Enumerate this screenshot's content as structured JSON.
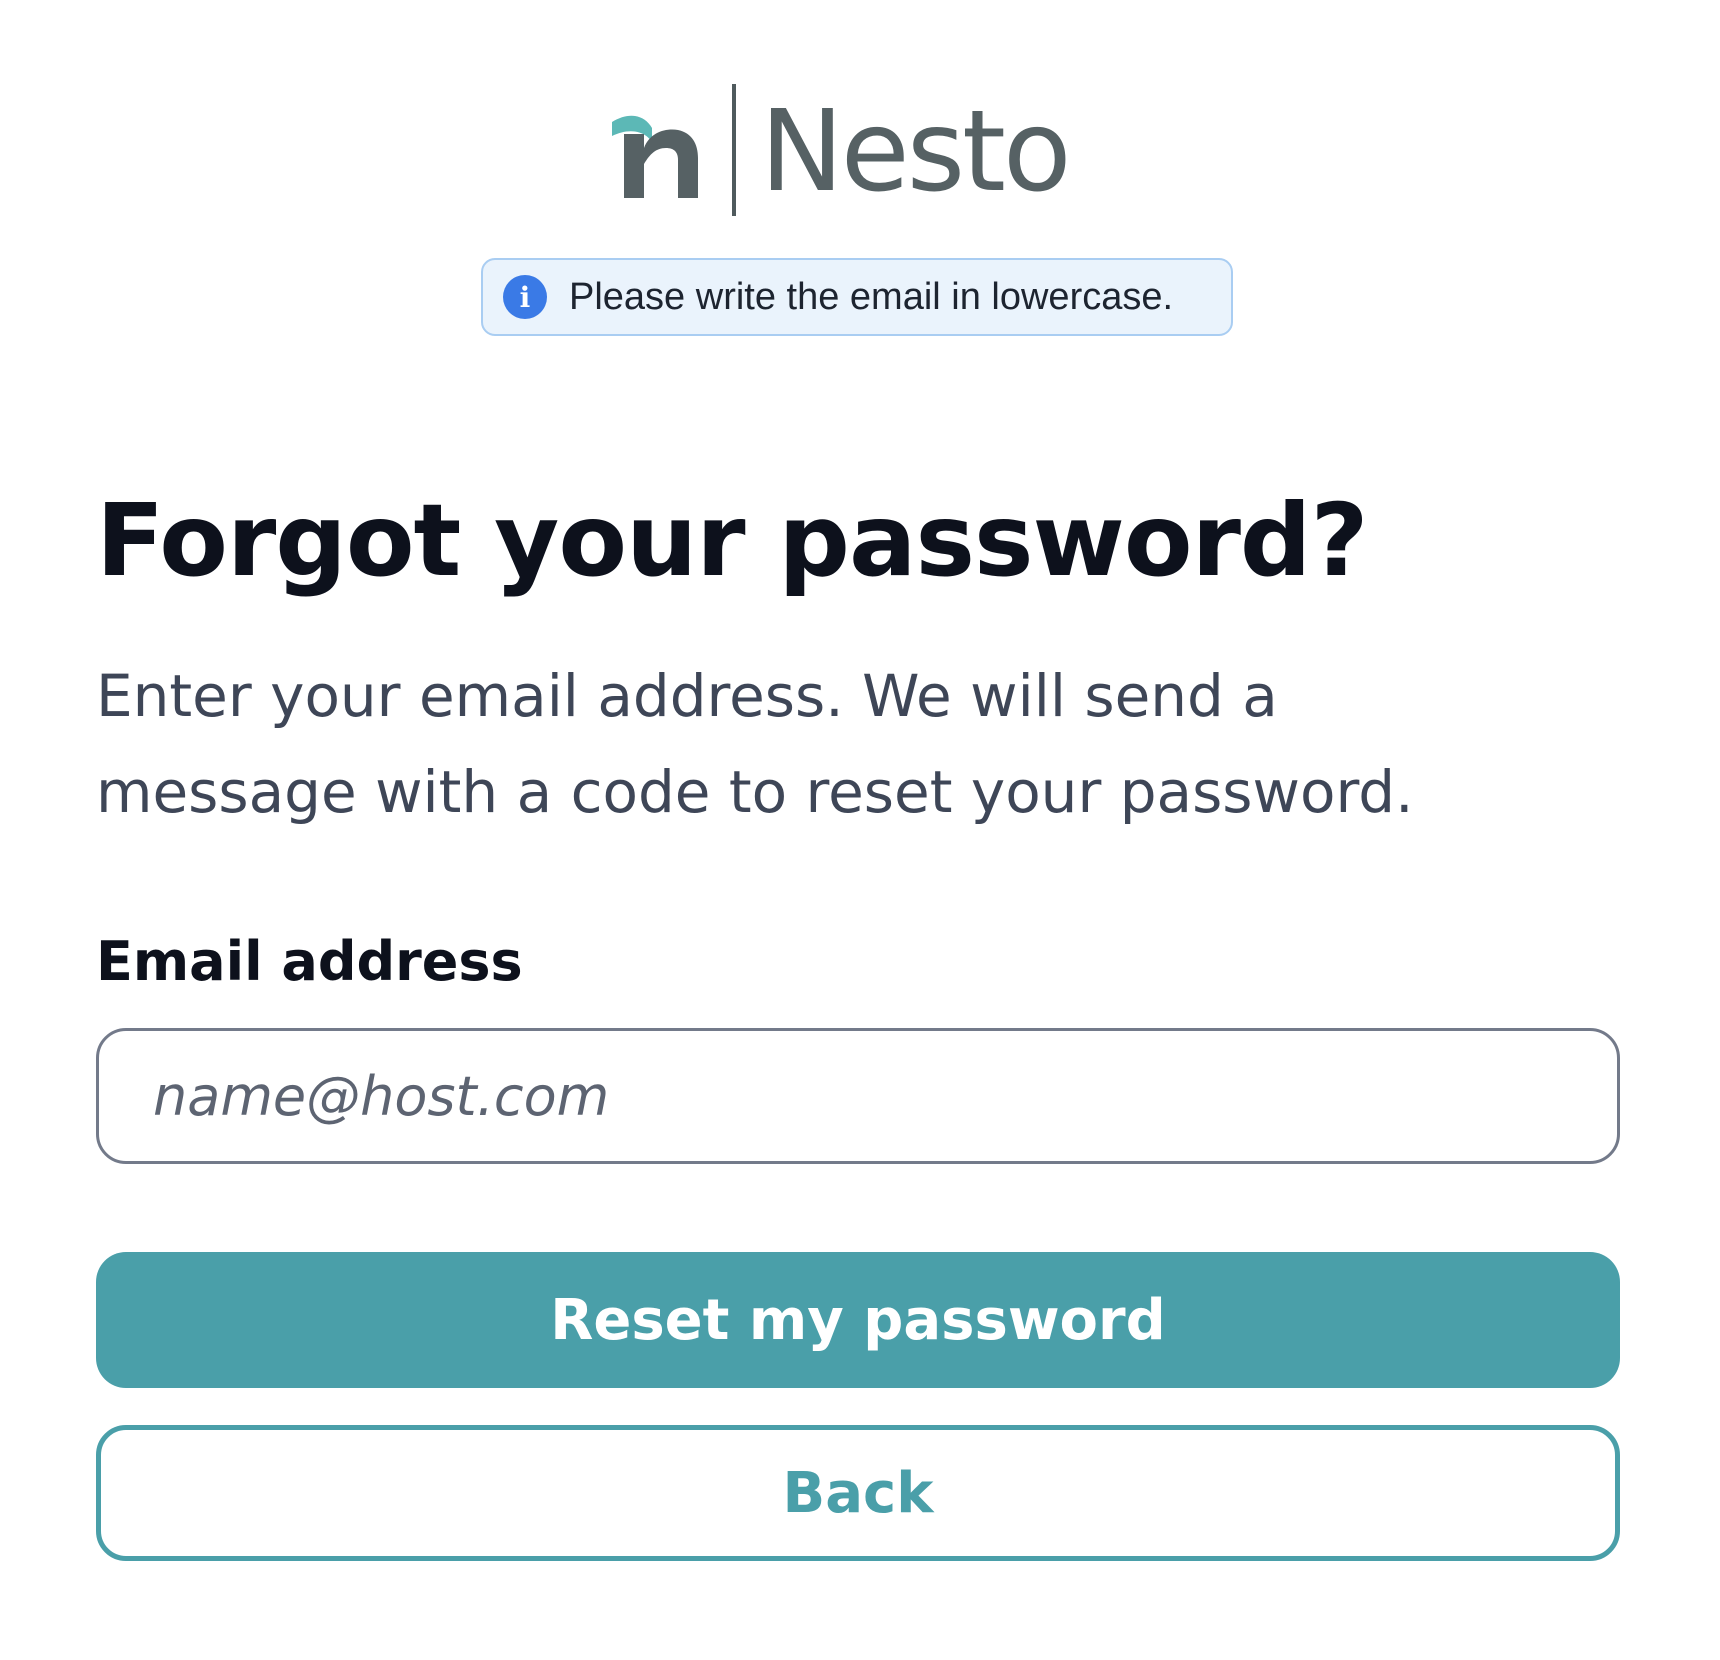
{
  "brand": {
    "name": "Nesto",
    "primary_color": "#4a9fa9",
    "logo_teal": "#5cb8b6",
    "logo_gray": "#566164"
  },
  "info_banner": {
    "icon": "info-icon",
    "icon_glyph": "i",
    "text": "Please write the email in lowercase."
  },
  "form": {
    "title": "Forgot your password?",
    "description": "Enter your email address. We will send a message with a code to reset your password.",
    "email_label": "Email address",
    "email_placeholder": "name@host.com",
    "email_value": "",
    "submit_label": "Reset my password",
    "back_label": "Back"
  }
}
